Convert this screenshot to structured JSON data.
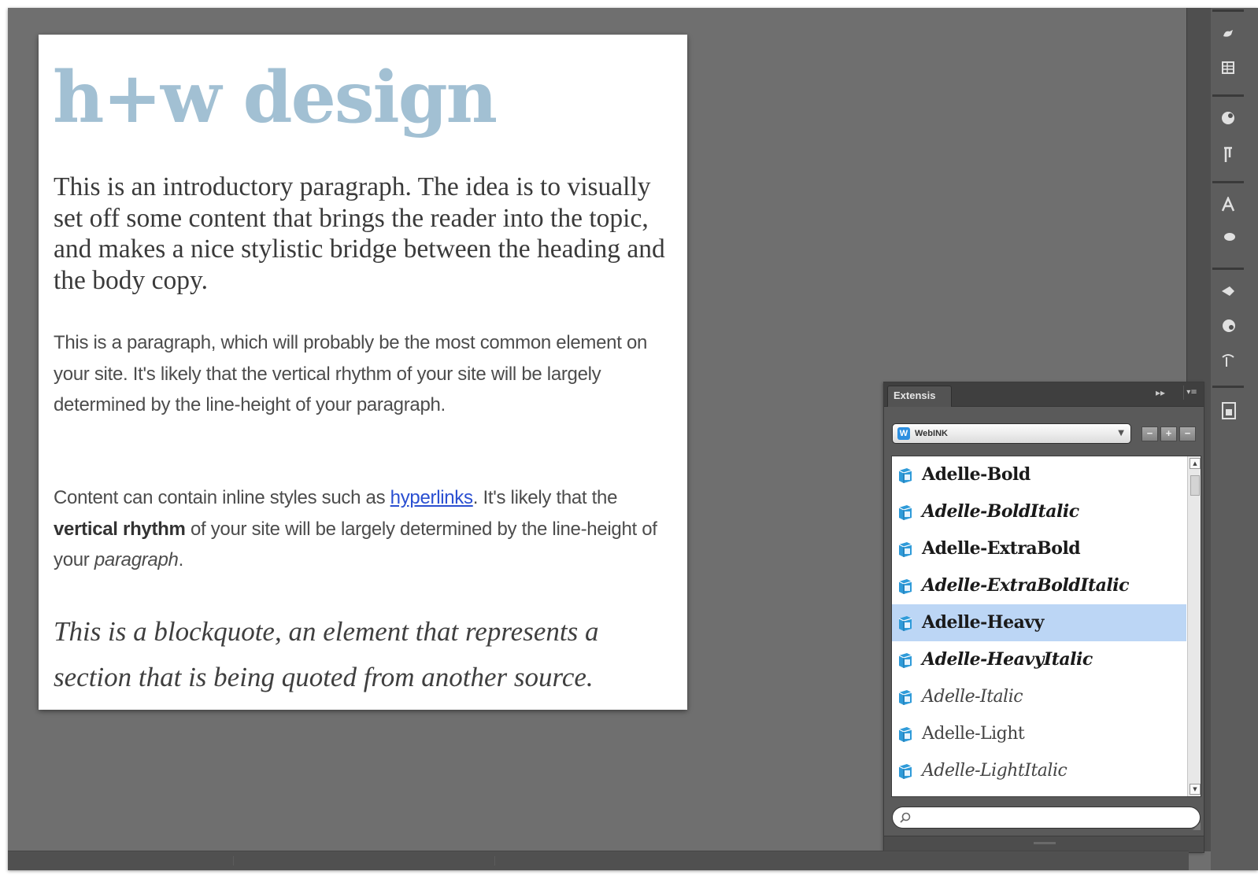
{
  "document": {
    "heading": "h+w design",
    "intro": "This is an introductory paragraph. The idea is to visually set off some content that brings the reader into the topic, and makes a nice stylistic bridge between the heading and the body copy.",
    "paragraph1": "This is a paragraph, which will probably be the most common element on your site. It's likely that the vertical rhythm of your site will be largely determined by the line-height of your paragraph.",
    "paragraph2": {
      "part1": "Content can contain inline styles such as ",
      "link": "hyperlinks",
      "part2": ". It's likely that the ",
      "bold": "vertical rhythm",
      "part3": " of your site will be largely determined by the line-height of your ",
      "italic": "paragraph",
      "part4": "."
    },
    "blockquote": "This is a blockquote, an element that represents a section that is being quoted from another source."
  },
  "panel": {
    "tab_label": "Extensis",
    "font_set": {
      "selected": "WebINK",
      "icon": "webink-icon"
    },
    "font_items": [
      {
        "name": "Adelle-Bold",
        "style": "bold",
        "selected": false
      },
      {
        "name": "Adelle-BoldItalic",
        "style": "bold-italic",
        "selected": false
      },
      {
        "name": "Adelle-ExtraBold",
        "style": "bold",
        "selected": false
      },
      {
        "name": "Adelle-ExtraBoldItalic",
        "style": "bold-italic",
        "selected": false
      },
      {
        "name": "Adelle-Heavy",
        "style": "bold",
        "selected": true
      },
      {
        "name": "Adelle-HeavyItalic",
        "style": "bold-italic",
        "selected": false
      },
      {
        "name": "Adelle-Italic",
        "style": "italic",
        "selected": false
      },
      {
        "name": "Adelle-Light",
        "style": "light",
        "selected": false
      },
      {
        "name": "Adelle-LightItalic",
        "style": "light-italic",
        "selected": false
      }
    ],
    "search": {
      "placeholder": "",
      "value": ""
    }
  },
  "colors": {
    "heading": "#a2c0d3",
    "link": "#2a4fd1",
    "selection": "#bcd6f5",
    "canvas": "#6f6f6f"
  },
  "icons": {
    "tool_strip": [
      "hand-icon",
      "table-icon",
      "color-icon",
      "paragraph-icon",
      "type-icon",
      "brush-icon",
      "layers-icon",
      "swatch-icon",
      "path-icon",
      "panel-icon"
    ],
    "font_item": "font-file-icon",
    "search": "search-icon"
  }
}
